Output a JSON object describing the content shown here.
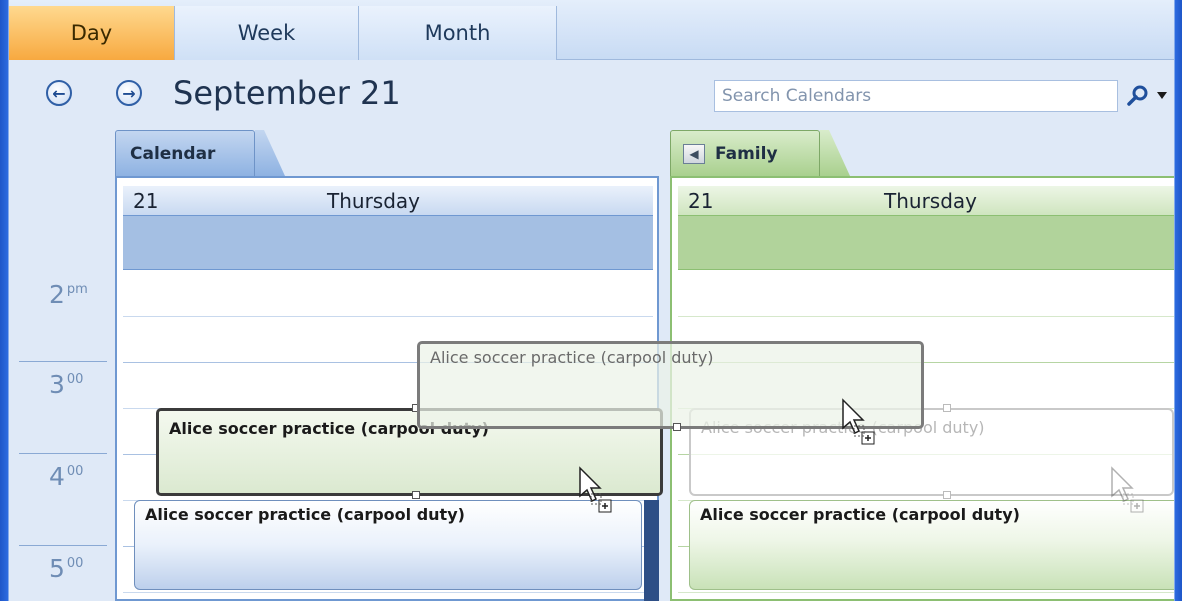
{
  "view_tabs": {
    "day": "Day",
    "week": "Week",
    "month": "Month",
    "active": "day"
  },
  "header": {
    "date_title": "September 21",
    "search_placeholder": "Search Calendars"
  },
  "times": [
    {
      "hour": "2",
      "suffix": "pm"
    },
    {
      "hour": "3",
      "suffix": "00"
    },
    {
      "hour": "4",
      "suffix": "00"
    },
    {
      "hour": "5",
      "suffix": "00"
    }
  ],
  "calendars": [
    {
      "tab_label": "Calendar",
      "day_number": "21",
      "day_name": "Thursday",
      "color": "#a4bfe3"
    },
    {
      "tab_label": "Family",
      "day_number": "21",
      "day_name": "Thursday",
      "color": "#b1d39b"
    }
  ],
  "appointments": {
    "drag_ghost": "Alice soccer practice (carpool duty)",
    "drag_source": "Alice soccer practice (carpool duty)",
    "family_faded": "Alice soccer practice (carpool duty)",
    "calendar_event": "Alice soccer practice (carpool duty)",
    "family_event": "Alice soccer practice (carpool duty)"
  }
}
